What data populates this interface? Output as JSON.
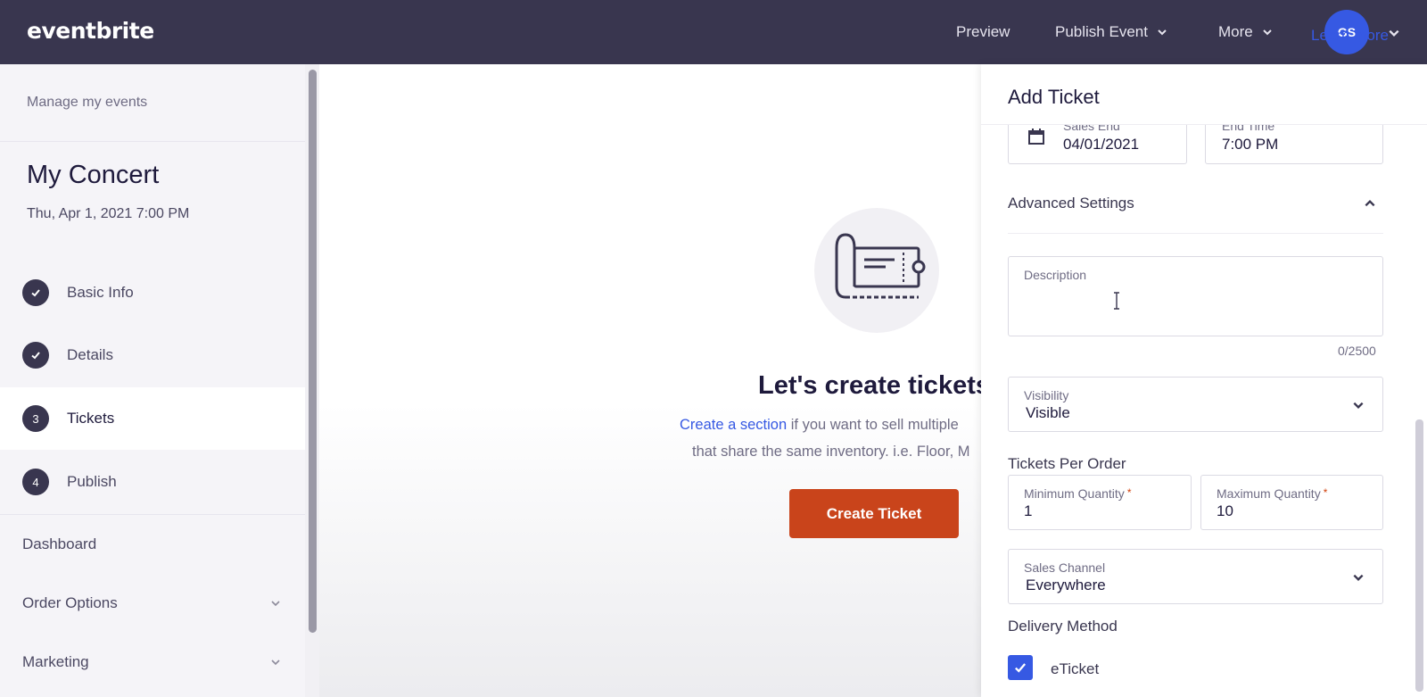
{
  "app": {
    "logo": "eventbrite"
  },
  "topnav": {
    "preview": "Preview",
    "publish_event": "Publish Event",
    "more": "More",
    "avatar_initials": "GS"
  },
  "sidebar": {
    "manage_link": "Manage my events",
    "event_title": "My Concert",
    "event_date": "Thu, Apr 1, 2021 7:00 PM",
    "steps": [
      {
        "marker": "check",
        "label": "Basic Info"
      },
      {
        "marker": "check",
        "label": "Details"
      },
      {
        "marker": "3",
        "label": "Tickets"
      },
      {
        "marker": "4",
        "label": "Publish"
      }
    ],
    "menu": [
      {
        "label": "Dashboard"
      },
      {
        "label": "Order Options"
      },
      {
        "label": "Marketing"
      }
    ]
  },
  "main": {
    "heading": "Let's create tickets",
    "link_text": "Create a section",
    "sub_text_1": " if you want to sell multiple",
    "sub_text_2": "that share the same inventory. i.e. Floor, M",
    "create_button": "Create Ticket"
  },
  "panel": {
    "title": "Add Ticket",
    "learn_more": "Learn more",
    "sales_end_label": "Sales End",
    "sales_end_value": "04/01/2021",
    "end_time_label": "End Time",
    "end_time_value": "7:00 PM",
    "advanced_settings": "Advanced Settings",
    "description_label": "Description",
    "description_counter": "0/2500",
    "visibility_label": "Visibility",
    "visibility_value": "Visible",
    "tickets_per_order": "Tickets Per Order",
    "min_qty_label": "Minimum Quantity",
    "min_qty_value": "1",
    "max_qty_label": "Maximum Quantity",
    "max_qty_value": "10",
    "required_marker": "*",
    "sales_channel_label": "Sales Channel",
    "sales_channel_value": "Everywhere",
    "delivery_method": "Delivery Method",
    "eticket_label": "eTicket",
    "eticket_checked": true
  },
  "colors": {
    "topbar": "#39364f",
    "accent_blue": "#3659e3",
    "cta_orange": "#c9441b"
  }
}
